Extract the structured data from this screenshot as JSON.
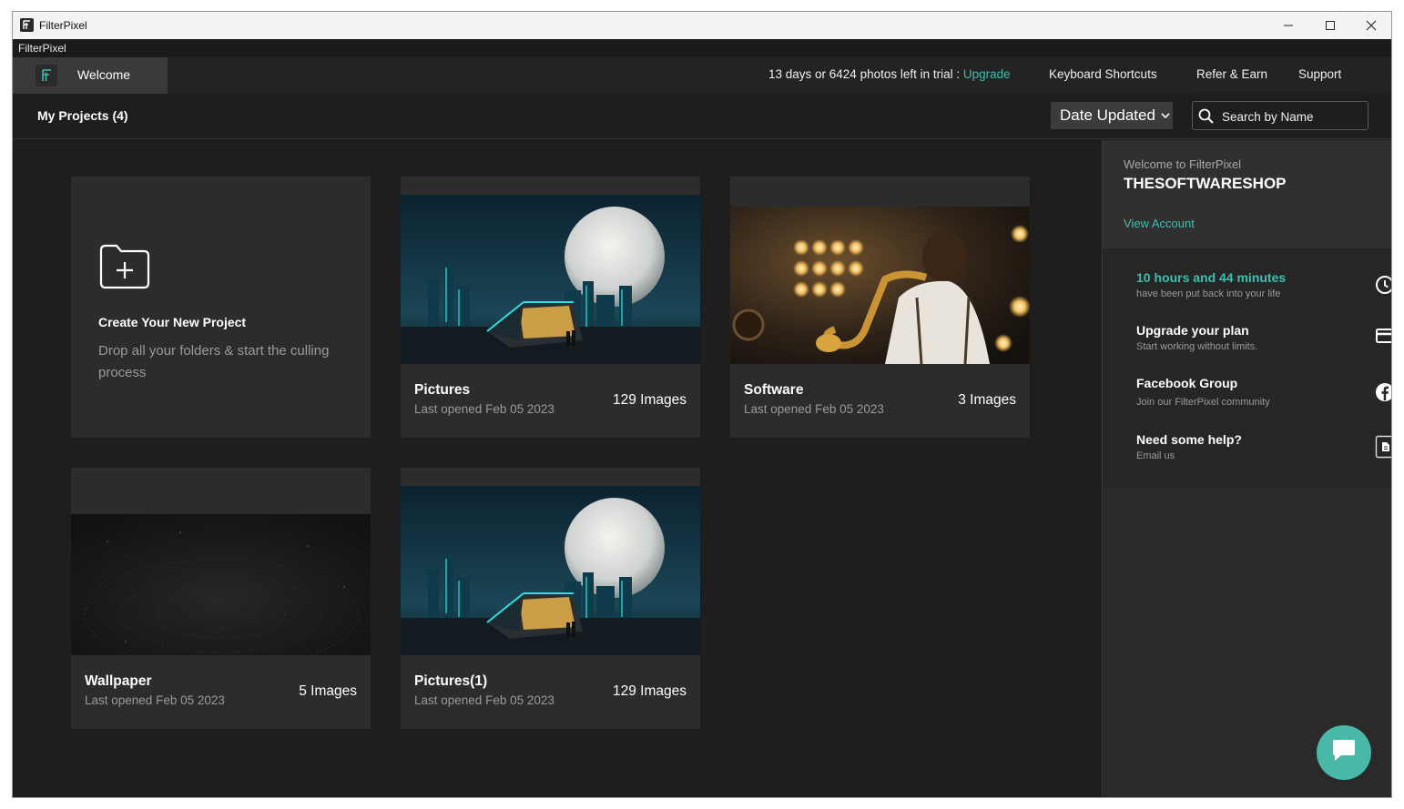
{
  "window": {
    "title": "FilterPixel",
    "menu_label": "FilterPixel"
  },
  "topnav": {
    "welcome_tab": "Welcome",
    "trial_text": "13 days or 6424 photos left in trial :",
    "upgrade_link": "Upgrade",
    "keyboard_shortcuts": "Keyboard Shortcuts",
    "refer_earn": "Refer & Earn",
    "support": "Support"
  },
  "projects_bar": {
    "title": "My Projects (4)",
    "sort_selected": "Date Updated",
    "search_placeholder": "Search by Name"
  },
  "new_project": {
    "title": "Create Your New Project",
    "description": "Drop all your folders & start the culling process"
  },
  "projects": [
    {
      "name": "Pictures",
      "opened": "Last opened Feb 05 2023",
      "count": "129 Images",
      "thumb": "moon-city"
    },
    {
      "name": "Software",
      "opened": "Last opened Feb 05 2023",
      "count": "3 Images",
      "thumb": "saxophone"
    },
    {
      "name": "Wallpaper",
      "opened": "Last opened Feb 05 2023",
      "count": "5 Images",
      "thumb": "dark-particles"
    },
    {
      "name": "Pictures(1)",
      "opened": "Last opened Feb 05 2023",
      "count": "129 Images",
      "thumb": "moon-city"
    }
  ],
  "sidebar": {
    "welcome": "Welcome to FilterPixel",
    "username": "THESOFTWARESHOP",
    "view_account": "View Account",
    "items": [
      {
        "title": "10 hours and 44 minutes",
        "subtitle": "have been put back into your life",
        "icon": "clock-icon"
      },
      {
        "title": "Upgrade your plan",
        "subtitle": "Start working without limits.",
        "icon": "credit-card-icon"
      },
      {
        "title": "Facebook Group",
        "subtitle": "Join our FilterPixel community",
        "icon": "facebook-icon"
      },
      {
        "title": "Need some help?",
        "subtitle": "Email us",
        "icon": "document-icon"
      }
    ]
  },
  "colors": {
    "accent": "#3dbfb0",
    "background": "#1e1e1e",
    "card": "#2c2c2c",
    "chat_button": "#49b8a8"
  }
}
